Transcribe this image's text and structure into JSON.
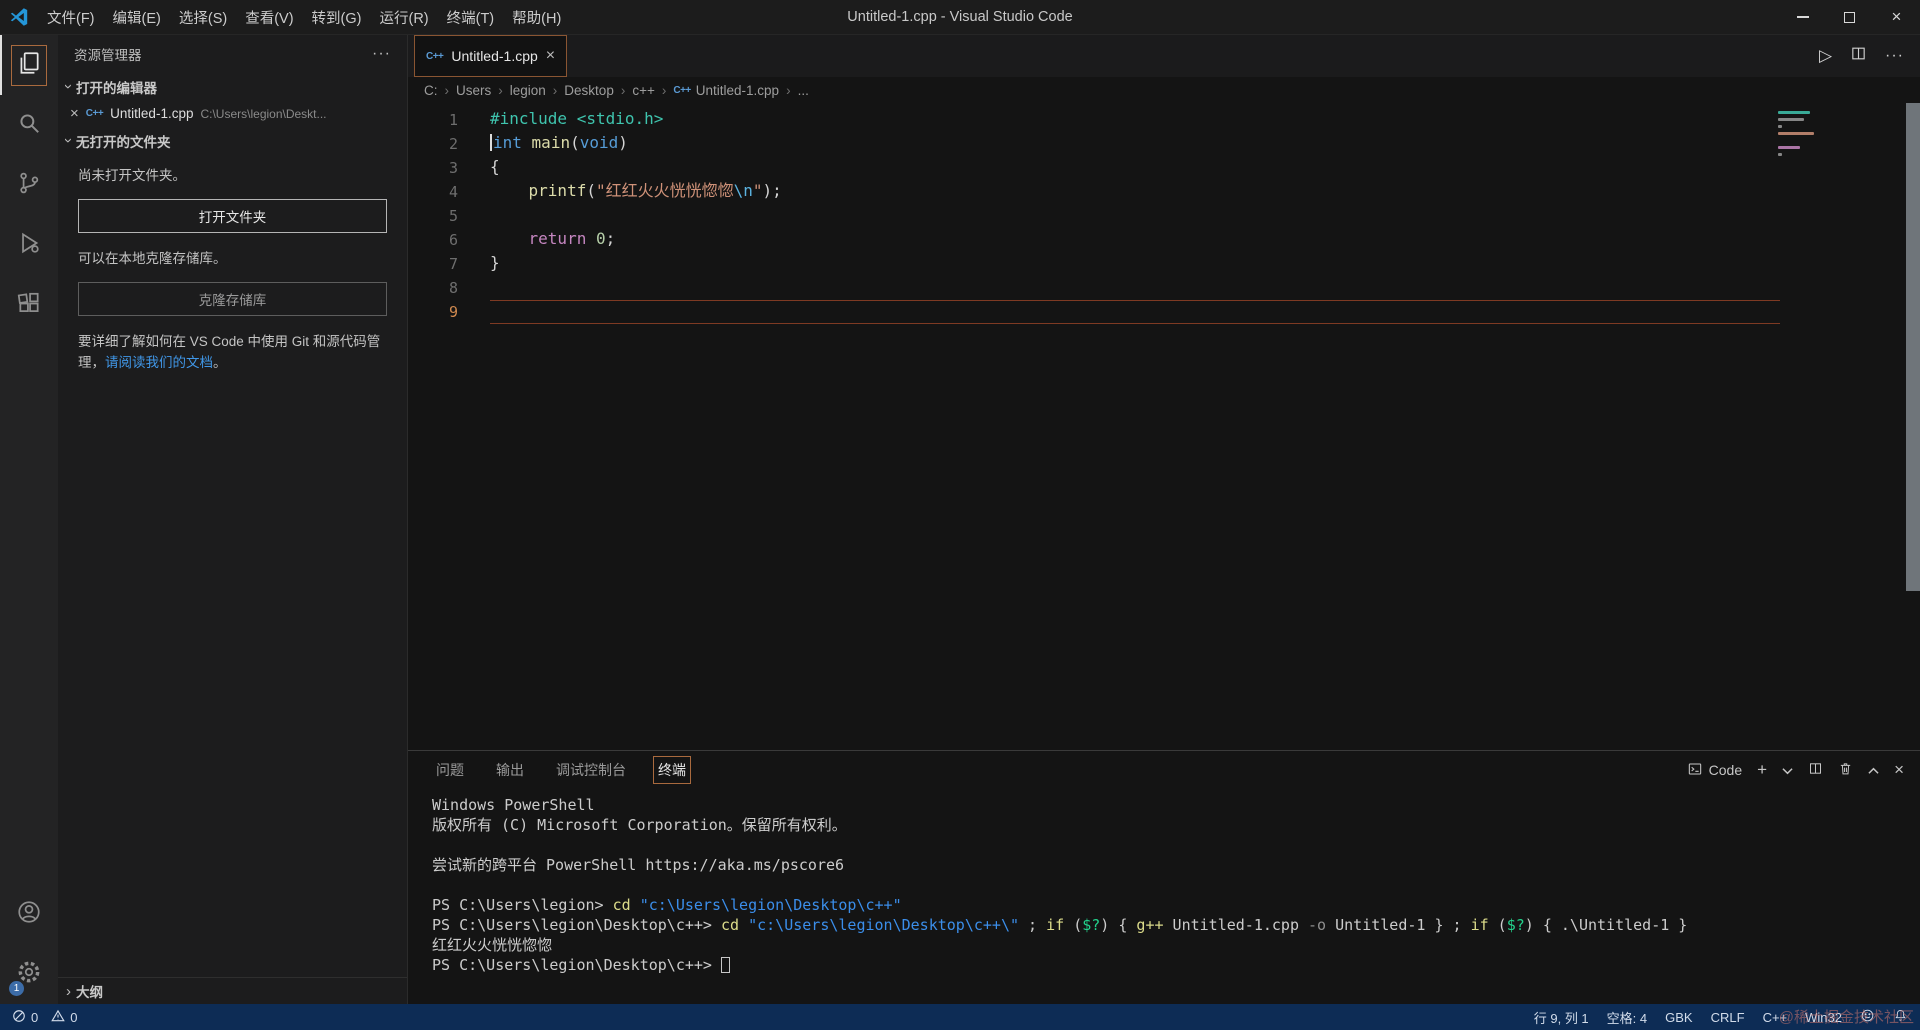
{
  "title_bar": {
    "menus": [
      "文件(F)",
      "编辑(E)",
      "选择(S)",
      "查看(V)",
      "转到(G)",
      "运行(R)",
      "终端(T)",
      "帮助(H)"
    ],
    "title": "Untitled-1.cpp - Visual Studio Code"
  },
  "icons": {
    "close": "×",
    "more": "···",
    "run": "▷",
    "plus": "+"
  },
  "sidebar": {
    "header": "资源管理器",
    "open_editors": {
      "label": "打开的编辑器",
      "file_name": "Untitled-1.cpp",
      "file_path": "C:\\Users\\legion\\Deskt..."
    },
    "no_folder": {
      "label": "无打开的文件夹",
      "hint_open": "尚未打开文件夹。",
      "open_button": "打开文件夹",
      "hint_clone": "可以在本地克隆存储库。",
      "clone_button": "克隆存储库",
      "docs_text": "要详细了解如何在 VS Code 中使用 Git 和源代码管理，",
      "docs_link": "请阅读我们的文档",
      "docs_suffix": "。"
    },
    "outline": {
      "label": "大纲"
    }
  },
  "editor": {
    "tab": {
      "icon_text": "C++",
      "label": "Untitled-1.cpp"
    },
    "breadcrumb": [
      "C:",
      "Users",
      "legion",
      "Desktop",
      "c++",
      "Untitled-1.cpp",
      "..."
    ],
    "breadcrumb_file_index": 5,
    "current_line": 9,
    "lines": [
      {
        "num": 1,
        "tokens": [
          [
            "#include",
            "teal"
          ],
          [
            " ",
            "plain"
          ],
          [
            "<stdio.h>",
            "teal"
          ]
        ]
      },
      {
        "num": 2,
        "cursor_bar": true,
        "tokens": [
          [
            "int",
            "blue"
          ],
          [
            " ",
            "plain"
          ],
          [
            "main",
            "yellow"
          ],
          [
            "(",
            "plain"
          ],
          [
            "void",
            "blue"
          ],
          [
            ")",
            "plain"
          ]
        ]
      },
      {
        "num": 3,
        "tokens": [
          [
            "{",
            "plain"
          ]
        ]
      },
      {
        "num": 4,
        "tokens": [
          [
            "    ",
            "plain"
          ],
          [
            "printf",
            "yellow"
          ],
          [
            "(",
            "plain"
          ],
          [
            "\"红红火火恍恍惚惚",
            "orange"
          ],
          [
            "\\n",
            "esc"
          ],
          [
            "\"",
            "orange"
          ],
          [
            ");",
            "plain"
          ]
        ]
      },
      {
        "num": 5,
        "tokens": []
      },
      {
        "num": 6,
        "tokens": [
          [
            "    ",
            "plain"
          ],
          [
            "return",
            "purple"
          ],
          [
            " ",
            "plain"
          ],
          [
            "0",
            "green"
          ],
          [
            ";",
            "plain"
          ]
        ]
      },
      {
        "num": 7,
        "tokens": [
          [
            "}",
            "plain"
          ]
        ]
      },
      {
        "num": 8,
        "tokens": []
      },
      {
        "num": 9,
        "tokens": []
      }
    ]
  },
  "panel": {
    "tabs": [
      {
        "label": "问题",
        "active": false
      },
      {
        "label": "输出",
        "active": false
      },
      {
        "label": "调试控制台",
        "active": false
      },
      {
        "label": "终端",
        "active": true
      }
    ],
    "shell_label": "Code",
    "terminal": [
      {
        "tokens": [
          [
            "Windows PowerShell",
            "white"
          ]
        ]
      },
      {
        "tokens": [
          [
            "版权所有 (C) Microsoft Corporation。保留所有权利。",
            "white"
          ]
        ]
      },
      {
        "tokens": []
      },
      {
        "tokens": [
          [
            "尝试新的跨平台 PowerShell https://aka.ms/pscore6",
            "white"
          ]
        ]
      },
      {
        "tokens": []
      },
      {
        "tokens": [
          [
            "PS C:\\Users\\legion> ",
            "white"
          ],
          [
            "cd",
            "yellow"
          ],
          [
            " ",
            "white"
          ],
          [
            "\"c:\\Users\\legion\\Desktop\\c++\"",
            "blue"
          ]
        ]
      },
      {
        "tokens": [
          [
            "PS C:\\Users\\legion\\Desktop\\c++> ",
            "white"
          ],
          [
            "cd",
            "yellow"
          ],
          [
            " ",
            "white"
          ],
          [
            "\"c:\\Users\\legion\\Desktop\\c++\\\"",
            "blue"
          ],
          [
            " ; ",
            "white"
          ],
          [
            "if",
            "yellow"
          ],
          [
            " (",
            "white"
          ],
          [
            "$?",
            "green"
          ],
          [
            ") { ",
            "white"
          ],
          [
            "g++",
            "yellow"
          ],
          [
            " Untitled-1.cpp ",
            "white"
          ],
          [
            "-o",
            "gray"
          ],
          [
            " Untitled-1 } ; ",
            "white"
          ],
          [
            "if",
            "yellow"
          ],
          [
            " (",
            "white"
          ],
          [
            "$?",
            "green"
          ],
          [
            ") { ",
            "white"
          ],
          [
            ".\\Untitled-1 }",
            "white"
          ]
        ]
      },
      {
        "tokens": [
          [
            "红红火火恍恍惚惚",
            "white"
          ]
        ]
      },
      {
        "tokens": [
          [
            "PS C:\\Users\\legion\\Desktop\\c++> ",
            "white"
          ],
          [
            "",
            "cursor"
          ]
        ]
      }
    ]
  },
  "status_bar": {
    "errors": "0",
    "warnings": "0",
    "items": [
      "行 9, 列 1",
      "空格: 4",
      "GBK",
      "CRLF",
      "C++",
      "Win32"
    ]
  },
  "watermark": "@稀土掘金技术社区"
}
